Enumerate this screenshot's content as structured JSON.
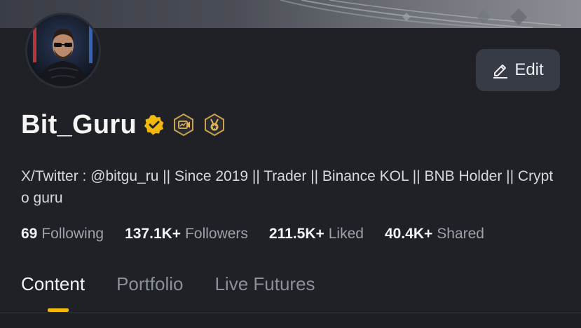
{
  "profile": {
    "username": "Bit_Guru",
    "bio": "X/Twitter : @bitgu_ru || Since 2019 || Trader || Binance KOL || BNB Holder || Crypto guru",
    "edit_label": "Edit"
  },
  "stats": [
    {
      "value": "69",
      "label": "Following"
    },
    {
      "value": "137.1K+",
      "label": "Followers"
    },
    {
      "value": "211.5K+",
      "label": "Liked"
    },
    {
      "value": "40.4K+",
      "label": "Shared"
    }
  ],
  "tabs": [
    {
      "label": "Content",
      "active": true
    },
    {
      "label": "Portfolio",
      "active": false
    },
    {
      "label": "Live Futures",
      "active": false
    }
  ],
  "badges": [
    "verified-check-icon",
    "live-stream-badge-icon",
    "medal-badge-icon"
  ],
  "colors": {
    "background": "#1f2127",
    "accent": "#f0b90b",
    "button": "#373b45",
    "muted_text": "#9ca1aa"
  }
}
